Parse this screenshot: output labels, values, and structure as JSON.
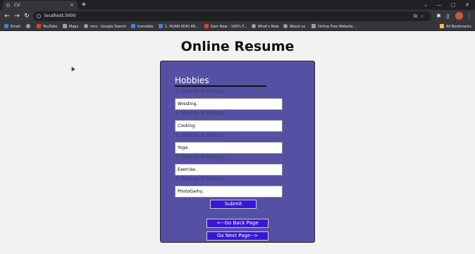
{
  "browser": {
    "tab_title": "CV",
    "tab_close": "×",
    "new_tab": "+",
    "url": "localhost:3000",
    "win_min": "—",
    "win_max": "▢",
    "win_close": "✕",
    "bookmarks": [
      {
        "label": "Email",
        "color": "#4a7bd4"
      },
      {
        "label": "",
        "color": "#9aa0a6"
      },
      {
        "label": "YouTube",
        "color": "#e53935"
      },
      {
        "label": "Maps",
        "color": "#9aa0a6"
      },
      {
        "label": "sms - Google Search",
        "color": "#9aa0a6"
      },
      {
        "label": "translate",
        "color": "#4a7bd4"
      },
      {
        "label": "1. HUAN XOIO INI...",
        "color": "#4a7bd4"
      },
      {
        "label": "Kam New - 100% F...",
        "color": "#e53935"
      },
      {
        "label": "What's New",
        "color": "#9aa0a6"
      },
      {
        "label": "About us",
        "color": "#9aa0a6"
      },
      {
        "label": "Online Free Website...",
        "color": "#9aa0a6"
      }
    ],
    "all_bookmarks": "All Bookmarks"
  },
  "page": {
    "title": "Online Resume",
    "section_title": "Hobbies",
    "hobbies": [
      {
        "label": "1 Name of Hobby",
        "value": "Wresting."
      },
      {
        "label": "1 Name of Hobby",
        "value": "Cooking."
      },
      {
        "label": "1 Name of Hobby",
        "value": "Yoga."
      },
      {
        "label": "1 Name of Hobby",
        "value": "Exercise.."
      },
      {
        "label": "1 Name of Hobby",
        "value": "PhotoGarhy."
      }
    ],
    "submit_label": "Submit",
    "back_label": "<--Go Back Page",
    "next_label": "Go Next Page-->"
  },
  "colors": {
    "card_bg": "#5550a3",
    "button_bg": "#3a16d6"
  }
}
